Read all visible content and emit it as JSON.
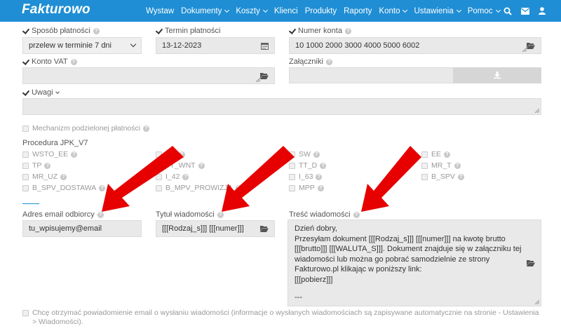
{
  "nav": {
    "logo": "Fakturowo",
    "items": [
      {
        "label": "Wystaw",
        "dropdown": false
      },
      {
        "label": "Dokumenty",
        "dropdown": true
      },
      {
        "label": "Koszty",
        "dropdown": true
      },
      {
        "label": "Klienci",
        "dropdown": false
      },
      {
        "label": "Produkty",
        "dropdown": false
      },
      {
        "label": "Raporty",
        "dropdown": false
      },
      {
        "label": "Konto",
        "dropdown": true
      },
      {
        "label": "Ustawienia",
        "dropdown": true
      },
      {
        "label": "Pomoc",
        "dropdown": true
      }
    ],
    "icons": [
      "search-icon",
      "mail-icon",
      "user-icon"
    ]
  },
  "payment": {
    "method_label": "Sposób płatności",
    "method_value": "przelew w terminie 7 dni",
    "term_label": "Termin płatności",
    "term_value": "13-12-2023",
    "account_label": "Numer konta",
    "account_value": "10 1000 2000 3000 4000 5000 6002",
    "vat_account_label": "Konto VAT",
    "vat_account_value": "",
    "attachments_label": "Załączniki",
    "notes_label": "Uwagi",
    "notes_value": ""
  },
  "split_payment": {
    "label": "Mechanizm podzielonej płatności"
  },
  "jpk": {
    "title": "Procedura JPK_V7",
    "col1": [
      "WSTO_EE",
      "TP",
      "MR_UZ",
      "B_SPV_DOSTAWA"
    ],
    "col2": [
      "ED",
      "TT_WNT",
      "I_42",
      "B_MPV_PROWIZJA"
    ],
    "col3": [
      "SW",
      "TT_D",
      "I_63",
      "MPP"
    ],
    "col4": [
      "EE",
      "MR_T",
      "B_SPV"
    ]
  },
  "email": {
    "address_label": "Adres email odbiorcy",
    "address_value": "tu_wpisujemy@email",
    "subject_label": "Tytuł wiadomości",
    "subject_value": "[[[Rodzaj_s]]] [[[numer]]]",
    "body_label": "Treść wiadomości",
    "body_lines": [
      "Dzień dobry,",
      "Przesyłam dokument [[[Rodzaj_s]]] [[[numer]]] na kwotę brutto",
      "[[[brutto]]] [[[WALUTA_S]]]. Dokument znajduje się w załączniku tej",
      "wiadomości lub można go pobrać samodzielnie ze strony",
      "Fakturowo.pl klikając w poniższy link:",
      "[[[pobierz]]]"
    ],
    "body_signature": "---"
  },
  "notify": {
    "label": "Chcę otrzymać powiadomienie email o wysłaniu wiadomości (informacje o wysłanych wiadomościach są zapisywane automatycznie na stronie - Ustawienia > Wiadomości)."
  },
  "colors": {
    "nav_bg": "#1f8ed4",
    "arrow": "#e60000",
    "field_bg": "#e9e9e9"
  }
}
